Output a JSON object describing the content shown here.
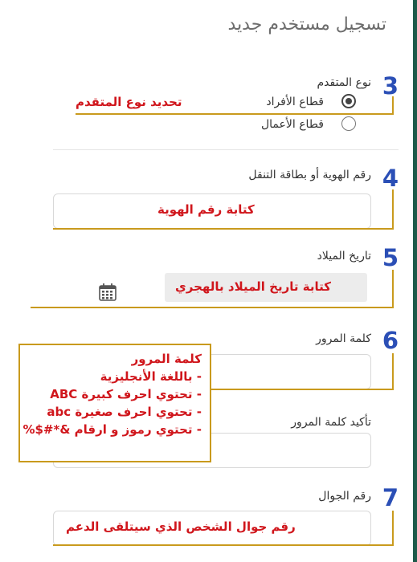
{
  "page": {
    "title": "تسجيل مستخدم جديد"
  },
  "sections": {
    "applicant_type": {
      "number": "3",
      "label": "نوع المتقدم",
      "annotation": "تحديد نوع المتقدم",
      "options": [
        {
          "label": "قطاع الأفراد",
          "selected": true
        },
        {
          "label": "قطاع الأعمال",
          "selected": false
        }
      ]
    },
    "id_number": {
      "number": "4",
      "label": "رقم الهوية أو بطاقة التنقل",
      "annotation": "كتابة رقم الهوية"
    },
    "birth_date": {
      "number": "5",
      "label": "تاريخ الميلاد",
      "annotation": "كتابة تاريخ الميلاد بالهجري",
      "icon": "calendar-icon"
    },
    "password": {
      "number": "6",
      "label": "كلمة المرور",
      "confirm_label": "تأكيد كلمة المرور",
      "rules": {
        "title": "كلمة المرور",
        "items": [
          "- باللغة الأنجليزية",
          "- تحتوي احرف كبيرة ABC",
          "- تحتوي احرف صغيرة abc",
          "- تحتوي رموز و ارقام &*#$%"
        ]
      }
    },
    "mobile": {
      "number": "7",
      "label": "رقم الجوال",
      "annotation": "رقم جوال الشخص الذي سيتلقى الدعم"
    }
  },
  "colors": {
    "accent_number": "#2b4fb6",
    "annotation_red": "#d0161c",
    "callout_gold": "#c99a1d",
    "side_bar": "#1e5a4a"
  }
}
